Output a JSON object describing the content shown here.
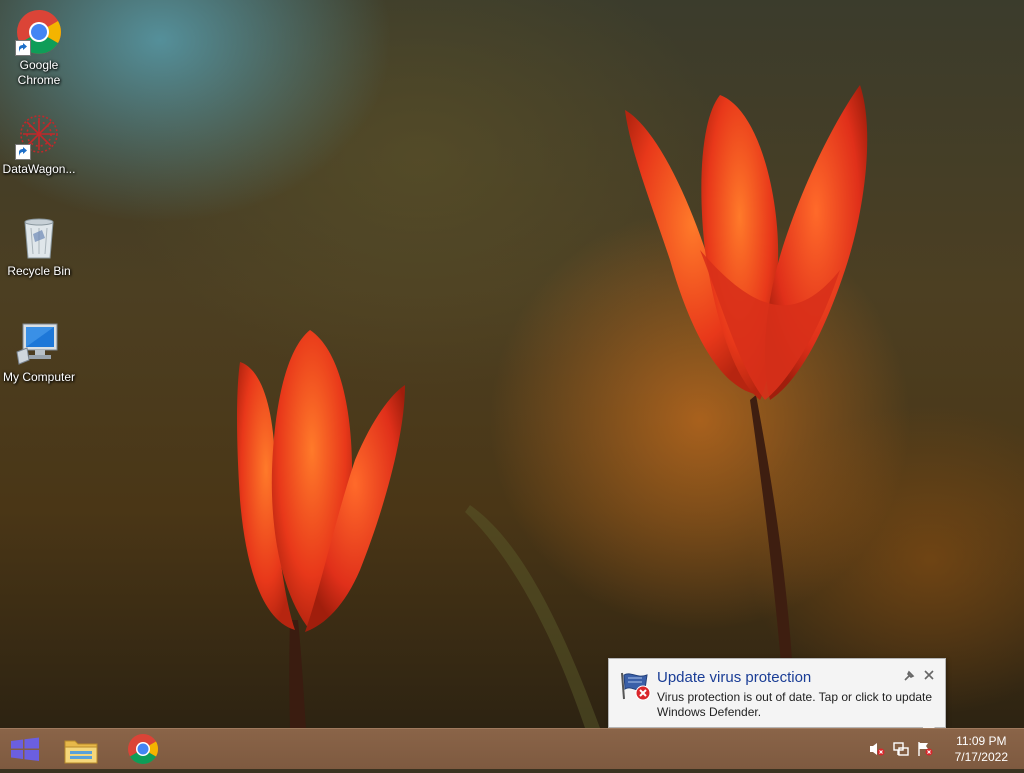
{
  "desktop": {
    "icons": [
      {
        "label_line1": "Google",
        "label_line2": "Chrome",
        "icon": "chrome-icon"
      },
      {
        "label": "DataWagon...",
        "icon": "datawagon-icon"
      },
      {
        "label": "Recycle Bin",
        "icon": "recycle-bin-icon"
      },
      {
        "label": "My Computer",
        "icon": "my-computer-icon"
      }
    ]
  },
  "notification": {
    "title": "Update virus protection",
    "body": "Virus protection is out of date. Tap or click to update Windows Defender.",
    "icon": "windows-defender-flag-icon"
  },
  "taskbar": {
    "pinned": [
      {
        "name": "file-explorer",
        "icon": "folder-icon"
      },
      {
        "name": "google-chrome",
        "icon": "chrome-icon"
      }
    ],
    "tray": {
      "volume_icon": "volume-muted-icon",
      "network_icon": "network-icon",
      "action_center_icon": "action-center-flag-icon"
    },
    "clock": {
      "time": "11:09 PM",
      "date": "7/17/2022"
    }
  },
  "colors": {
    "taskbar": "#7e5a40",
    "start_accent": "#6b5fe0",
    "notification_title": "#1a3d96"
  }
}
